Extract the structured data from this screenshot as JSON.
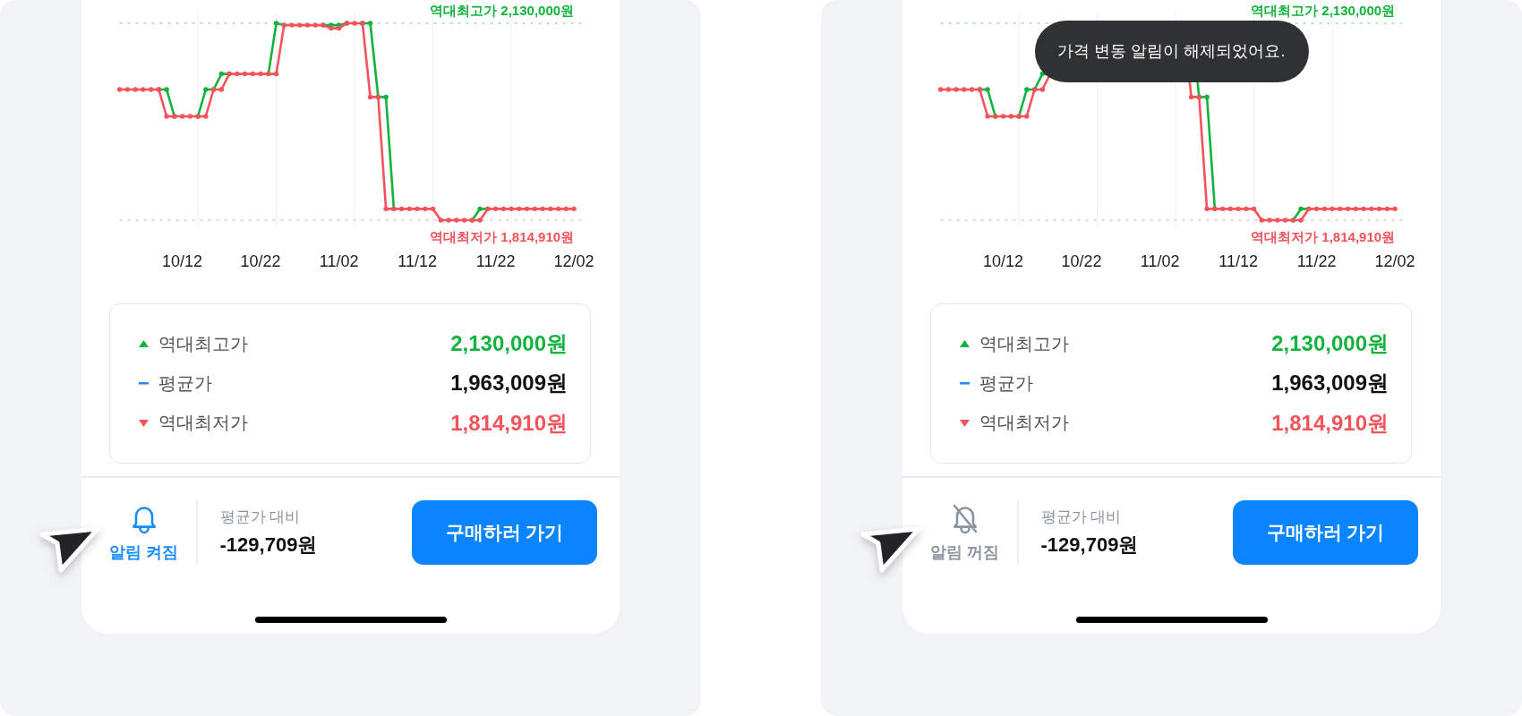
{
  "panels": [
    {
      "chart": {
        "reference_labels": [
          {
            "kind": "max",
            "label": "역대최고가 2,130,000원",
            "color": "#12b33c"
          },
          {
            "kind": "min",
            "label": "역대최저가 1,814,910원",
            "color": "#f5535c"
          }
        ],
        "date_labels": [
          "10/12",
          "10/22",
          "11/02",
          "11/12",
          "11/22",
          "12/02"
        ]
      },
      "summary": [
        {
          "kind": "up",
          "label": "역대최고가",
          "value": "2,130,000원",
          "color": "#12b33c"
        },
        {
          "kind": "flat",
          "label": "평균가",
          "value": "1,963,009원",
          "color": "#1a8cff"
        },
        {
          "kind": "down",
          "label": "역대최저가",
          "value": "1,814,910원",
          "color": "#f5535c"
        }
      ],
      "alarm": {
        "on": true,
        "label": "알림 켜짐"
      },
      "comparison": {
        "label": "평균가 대비",
        "value": "-129,709원"
      },
      "buy_button": "구매하러 가기"
    },
    {
      "chart": {
        "reference_labels": [
          {
            "kind": "max",
            "label": "역대최고가 2,130,000원",
            "color": "#12b33c"
          },
          {
            "kind": "min",
            "label": "역대최저가 1,814,910원",
            "color": "#f5535c"
          }
        ],
        "date_labels": [
          "10/12",
          "10/22",
          "11/02",
          "11/12",
          "11/22",
          "12/02"
        ]
      },
      "toast": "가격 변동 알림이 해제되었어요.",
      "summary": [
        {
          "kind": "up",
          "label": "역대최고가",
          "value": "2,130,000원",
          "color": "#12b33c"
        },
        {
          "kind": "flat",
          "label": "평균가",
          "value": "1,963,009원",
          "color": "#1a8cff"
        },
        {
          "kind": "down",
          "label": "역대최저가",
          "value": "1,814,910원",
          "color": "#f5535c"
        }
      ],
      "alarm": {
        "on": false,
        "label": "알림 꺼짐"
      },
      "comparison": {
        "label": "평균가 대비",
        "value": "-129,709원"
      },
      "buy_button": "구매하러 가기"
    }
  ]
}
